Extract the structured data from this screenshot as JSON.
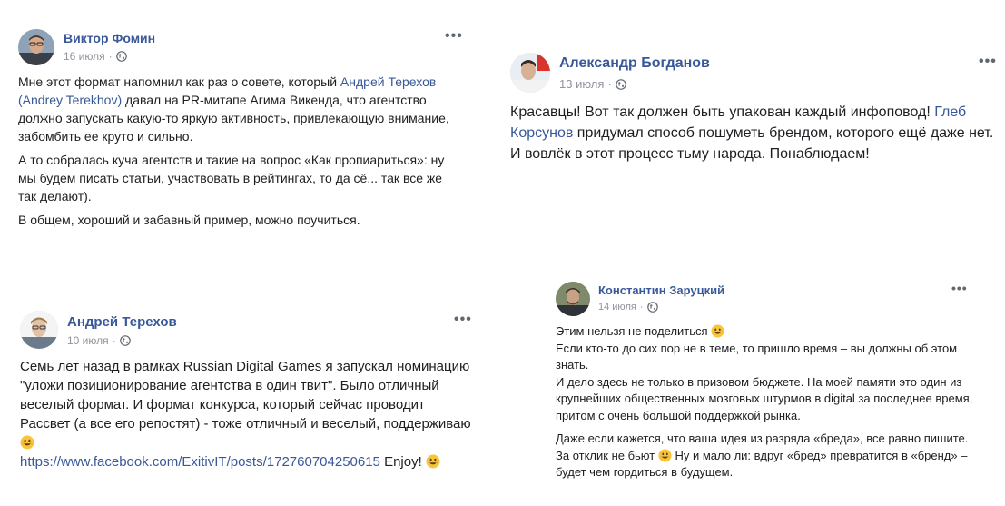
{
  "posts": [
    {
      "author": "Виктор Фомин",
      "date": "16 июля",
      "dot": "·",
      "more": "•••",
      "paragraphs": [
        {
          "t1": "Мне этот формат напомнил как раз о совете, который ",
          "link": "Андрей Терехов (Andrey Terekhov)",
          "t2": " давал на PR-митапе Агима Викенда, что агентство должно запускать какую-то яркую активность, привлекающую внимание, забомбить ее круто и сильно."
        },
        {
          "text": "А то собралась куча агентств и такие на вопрос «Как пропиариться»: ну мы будем писать статьи, участвовать в рейтингах, то да сё... так все же так делают)."
        },
        {
          "text": "В общем, хороший и забавный пример, можно поучиться."
        }
      ]
    },
    {
      "author": "Александр Богданов",
      "date": "13 июля",
      "dot": "·",
      "more": "•••",
      "t1": "Красавцы! Вот так должен быть упакован каждый инфоповод! ",
      "link": "Глеб Корсунов",
      "t2": " придумал способ пошуметь брендом, которого ещё даже нет. И вовлёк в этот процесс тьму народа. Понаблюдаем!"
    },
    {
      "author": "Андрей Терехов",
      "date": "10 июля",
      "dot": "·",
      "more": "•••",
      "t1": "Семь лет назад в рамках Russian Digital Games я запускал номинацию \"уложи позиционирование агентства в один твит\". Было отличный веселый формат. И формат конкурса, который сейчас проводит Рассвет (а все его репостят) - тоже отличный и веселый, поддерживаю ",
      "link": "https://www.facebook.com/ExitivIT/posts/172760704250615",
      "t2": " Enjoy! "
    },
    {
      "author": "Константин Заруцкий",
      "date": "14 июля",
      "dot": "·",
      "more": "•••",
      "p1_l1": "Этим нельзя не поделиться ",
      "p1_l2": "Если кто-то до сих пор не в теме, то пришло время – вы должны об этом знать.",
      "p1_l3": "И дело здесь не только в призовом бюджете. На моей памяти это один из крупнейших общественных мозговых штурмов в digital за последнее время, притом с очень большой поддержкой рынка.",
      "p2_t1": "Даже если кажется, что ваша идея из разряда «бреда», все равно пишите. За отклик не бьют ",
      "p2_t2": " Ну и мало ли: вдруг «бред» превратится в «бренд» – будет чем гордиться в будущем."
    }
  ],
  "icons": {
    "globe": "globe-icon",
    "emoji": "smiley-emoji-icon",
    "avatar": "profile-photo"
  }
}
